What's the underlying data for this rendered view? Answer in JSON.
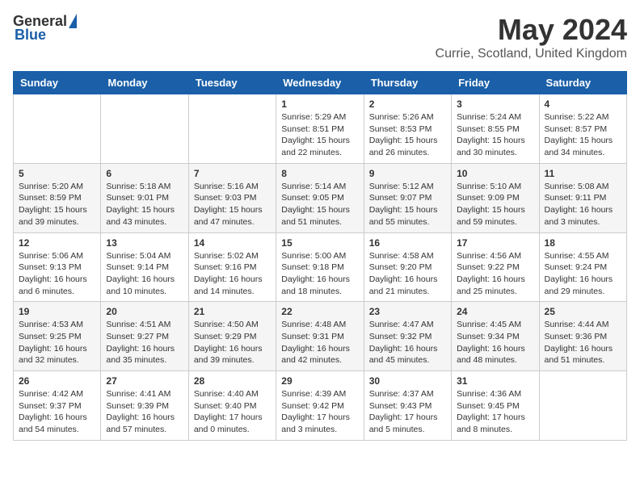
{
  "header": {
    "logo_general": "General",
    "logo_blue": "Blue",
    "month_title": "May 2024",
    "location": "Currie, Scotland, United Kingdom"
  },
  "days_of_week": [
    "Sunday",
    "Monday",
    "Tuesday",
    "Wednesday",
    "Thursday",
    "Friday",
    "Saturday"
  ],
  "weeks": [
    [
      {
        "day": "",
        "info": ""
      },
      {
        "day": "",
        "info": ""
      },
      {
        "day": "",
        "info": ""
      },
      {
        "day": "1",
        "info": "Sunrise: 5:29 AM\nSunset: 8:51 PM\nDaylight: 15 hours\nand 22 minutes."
      },
      {
        "day": "2",
        "info": "Sunrise: 5:26 AM\nSunset: 8:53 PM\nDaylight: 15 hours\nand 26 minutes."
      },
      {
        "day": "3",
        "info": "Sunrise: 5:24 AM\nSunset: 8:55 PM\nDaylight: 15 hours\nand 30 minutes."
      },
      {
        "day": "4",
        "info": "Sunrise: 5:22 AM\nSunset: 8:57 PM\nDaylight: 15 hours\nand 34 minutes."
      }
    ],
    [
      {
        "day": "5",
        "info": "Sunrise: 5:20 AM\nSunset: 8:59 PM\nDaylight: 15 hours\nand 39 minutes."
      },
      {
        "day": "6",
        "info": "Sunrise: 5:18 AM\nSunset: 9:01 PM\nDaylight: 15 hours\nand 43 minutes."
      },
      {
        "day": "7",
        "info": "Sunrise: 5:16 AM\nSunset: 9:03 PM\nDaylight: 15 hours\nand 47 minutes."
      },
      {
        "day": "8",
        "info": "Sunrise: 5:14 AM\nSunset: 9:05 PM\nDaylight: 15 hours\nand 51 minutes."
      },
      {
        "day": "9",
        "info": "Sunrise: 5:12 AM\nSunset: 9:07 PM\nDaylight: 15 hours\nand 55 minutes."
      },
      {
        "day": "10",
        "info": "Sunrise: 5:10 AM\nSunset: 9:09 PM\nDaylight: 15 hours\nand 59 minutes."
      },
      {
        "day": "11",
        "info": "Sunrise: 5:08 AM\nSunset: 9:11 PM\nDaylight: 16 hours\nand 3 minutes."
      }
    ],
    [
      {
        "day": "12",
        "info": "Sunrise: 5:06 AM\nSunset: 9:13 PM\nDaylight: 16 hours\nand 6 minutes."
      },
      {
        "day": "13",
        "info": "Sunrise: 5:04 AM\nSunset: 9:14 PM\nDaylight: 16 hours\nand 10 minutes."
      },
      {
        "day": "14",
        "info": "Sunrise: 5:02 AM\nSunset: 9:16 PM\nDaylight: 16 hours\nand 14 minutes."
      },
      {
        "day": "15",
        "info": "Sunrise: 5:00 AM\nSunset: 9:18 PM\nDaylight: 16 hours\nand 18 minutes."
      },
      {
        "day": "16",
        "info": "Sunrise: 4:58 AM\nSunset: 9:20 PM\nDaylight: 16 hours\nand 21 minutes."
      },
      {
        "day": "17",
        "info": "Sunrise: 4:56 AM\nSunset: 9:22 PM\nDaylight: 16 hours\nand 25 minutes."
      },
      {
        "day": "18",
        "info": "Sunrise: 4:55 AM\nSunset: 9:24 PM\nDaylight: 16 hours\nand 29 minutes."
      }
    ],
    [
      {
        "day": "19",
        "info": "Sunrise: 4:53 AM\nSunset: 9:25 PM\nDaylight: 16 hours\nand 32 minutes."
      },
      {
        "day": "20",
        "info": "Sunrise: 4:51 AM\nSunset: 9:27 PM\nDaylight: 16 hours\nand 35 minutes."
      },
      {
        "day": "21",
        "info": "Sunrise: 4:50 AM\nSunset: 9:29 PM\nDaylight: 16 hours\nand 39 minutes."
      },
      {
        "day": "22",
        "info": "Sunrise: 4:48 AM\nSunset: 9:31 PM\nDaylight: 16 hours\nand 42 minutes."
      },
      {
        "day": "23",
        "info": "Sunrise: 4:47 AM\nSunset: 9:32 PM\nDaylight: 16 hours\nand 45 minutes."
      },
      {
        "day": "24",
        "info": "Sunrise: 4:45 AM\nSunset: 9:34 PM\nDaylight: 16 hours\nand 48 minutes."
      },
      {
        "day": "25",
        "info": "Sunrise: 4:44 AM\nSunset: 9:36 PM\nDaylight: 16 hours\nand 51 minutes."
      }
    ],
    [
      {
        "day": "26",
        "info": "Sunrise: 4:42 AM\nSunset: 9:37 PM\nDaylight: 16 hours\nand 54 minutes."
      },
      {
        "day": "27",
        "info": "Sunrise: 4:41 AM\nSunset: 9:39 PM\nDaylight: 16 hours\nand 57 minutes."
      },
      {
        "day": "28",
        "info": "Sunrise: 4:40 AM\nSunset: 9:40 PM\nDaylight: 17 hours\nand 0 minutes."
      },
      {
        "day": "29",
        "info": "Sunrise: 4:39 AM\nSunset: 9:42 PM\nDaylight: 17 hours\nand 3 minutes."
      },
      {
        "day": "30",
        "info": "Sunrise: 4:37 AM\nSunset: 9:43 PM\nDaylight: 17 hours\nand 5 minutes."
      },
      {
        "day": "31",
        "info": "Sunrise: 4:36 AM\nSunset: 9:45 PM\nDaylight: 17 hours\nand 8 minutes."
      },
      {
        "day": "",
        "info": ""
      }
    ]
  ]
}
